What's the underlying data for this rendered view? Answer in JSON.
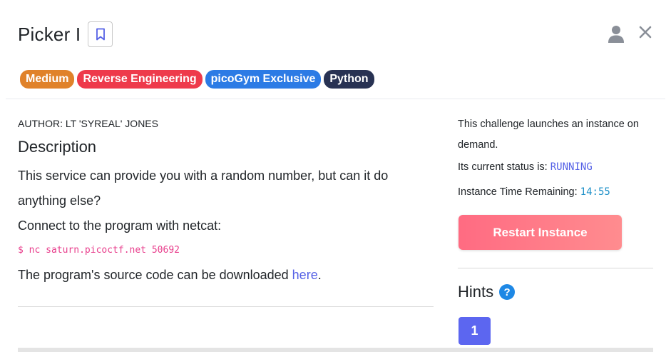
{
  "challenge": {
    "title": "Picker I"
  },
  "tags": [
    {
      "label": "Medium",
      "color": "#e0822a"
    },
    {
      "label": "Reverse Engineering",
      "color": "#ee3a4b"
    },
    {
      "label": "picoGym Exclusive",
      "color": "#2c7be5"
    },
    {
      "label": "Python",
      "color": "#283253"
    }
  ],
  "author": "AUTHOR: LT 'SYREAL' JONES",
  "description": {
    "heading": "Description",
    "line1": "This service can provide you with a random number, but can it do anything else?",
    "line2": "Connect to the program with netcat:",
    "command": "$ nc saturn.picoctf.net 50692",
    "line3_prefix": "The program's source code can be downloaded ",
    "line3_link": "here",
    "line3_suffix": "."
  },
  "instance": {
    "intro": "This challenge launches an instance on demand.",
    "status_label": "Its current status is: ",
    "status_value": "RUNNING",
    "time_label": "Instance Time Remaining: ",
    "time_value": "14:55",
    "restart_label": "Restart Instance"
  },
  "hints": {
    "heading": "Hints",
    "help_icon": "?",
    "items": [
      "1"
    ]
  },
  "icons": {
    "bookmark": "bookmark-icon",
    "user": "user-icon",
    "close": "close-icon",
    "help": "question-circle-icon"
  }
}
